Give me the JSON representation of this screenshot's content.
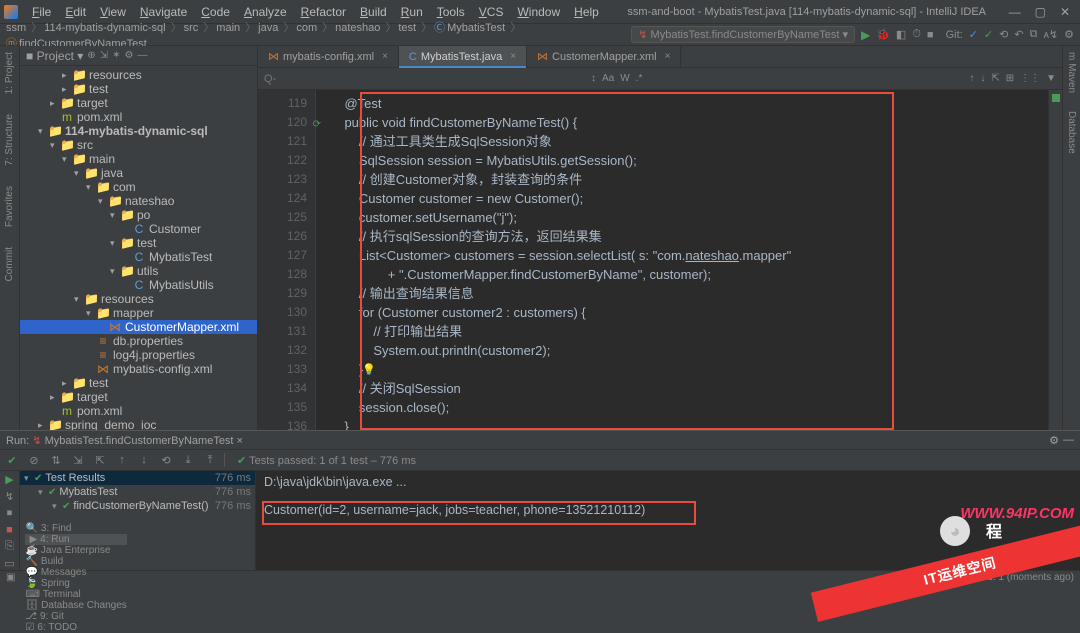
{
  "window": {
    "title": "ssm-and-boot - MybatisTest.java [114-mybatis-dynamic-sql] - IntelliJ IDEA",
    "menu": [
      "File",
      "Edit",
      "View",
      "Navigate",
      "Code",
      "Analyze",
      "Refactor",
      "Build",
      "Run",
      "Tools",
      "VCS",
      "Window",
      "Help"
    ]
  },
  "breadcrumb": {
    "items": [
      "ssm",
      "114-mybatis-dynamic-sql",
      "src",
      "main",
      "java",
      "com",
      "nateshao",
      "test",
      "MybatisTest",
      "findCustomerByNameTest"
    ],
    "run_config": "MybatisTest.findCustomerByNameTest",
    "git_label": "Git:"
  },
  "left_tools": [
    "1: Project",
    "7: Structure",
    "Favorites",
    "Commit"
  ],
  "right_tools": [
    "Maven",
    "Database"
  ],
  "project_tree": [
    {
      "d": 3,
      "a": "▸",
      "i": "📁",
      "c": "ic-folder-y",
      "t": "resources"
    },
    {
      "d": 3,
      "a": "▸",
      "i": "📁",
      "c": "ic-folder-b",
      "t": "test"
    },
    {
      "d": 2,
      "a": "▸",
      "i": "📁",
      "c": "ic-folder-y",
      "t": "target"
    },
    {
      "d": 2,
      "a": "",
      "i": "m",
      "c": "ic-file-x",
      "t": "pom.xml"
    },
    {
      "d": 1,
      "a": "▾",
      "i": "📁",
      "c": "ic-folder",
      "t": "114-mybatis-dynamic-sql",
      "bold": true
    },
    {
      "d": 2,
      "a": "▾",
      "i": "📁",
      "c": "ic-folder-b",
      "t": "src"
    },
    {
      "d": 3,
      "a": "▾",
      "i": "📁",
      "c": "ic-folder-b",
      "t": "main"
    },
    {
      "d": 4,
      "a": "▾",
      "i": "📁",
      "c": "ic-folder-b",
      "t": "java"
    },
    {
      "d": 5,
      "a": "▾",
      "i": "📁",
      "c": "ic-folder",
      "t": "com"
    },
    {
      "d": 6,
      "a": "▾",
      "i": "📁",
      "c": "ic-folder",
      "t": "nateshao"
    },
    {
      "d": 7,
      "a": "▾",
      "i": "📁",
      "c": "ic-folder",
      "t": "po"
    },
    {
      "d": 8,
      "a": "",
      "i": "C",
      "c": "ic-class",
      "t": "Customer"
    },
    {
      "d": 7,
      "a": "▾",
      "i": "📁",
      "c": "ic-folder",
      "t": "test"
    },
    {
      "d": 8,
      "a": "",
      "i": "C",
      "c": "ic-class",
      "t": "MybatisTest"
    },
    {
      "d": 7,
      "a": "▾",
      "i": "📁",
      "c": "ic-folder",
      "t": "utils"
    },
    {
      "d": 8,
      "a": "",
      "i": "C",
      "c": "ic-class",
      "t": "MybatisUtils"
    },
    {
      "d": 4,
      "a": "▾",
      "i": "📁",
      "c": "ic-folder-y",
      "t": "resources"
    },
    {
      "d": 5,
      "a": "▾",
      "i": "📁",
      "c": "ic-folder",
      "t": "mapper"
    },
    {
      "d": 6,
      "a": "",
      "i": "⋈",
      "c": "ic-file-p",
      "t": "CustomerMapper.xml",
      "sel": true
    },
    {
      "d": 5,
      "a": "",
      "i": "≡",
      "c": "ic-file-p",
      "t": "db.properties"
    },
    {
      "d": 5,
      "a": "",
      "i": "≡",
      "c": "ic-file-p",
      "t": "log4j.properties"
    },
    {
      "d": 5,
      "a": "",
      "i": "⋈",
      "c": "ic-file-p",
      "t": "mybatis-config.xml"
    },
    {
      "d": 3,
      "a": "▸",
      "i": "📁",
      "c": "ic-folder-b",
      "t": "test"
    },
    {
      "d": 2,
      "a": "▸",
      "i": "📁",
      "c": "ic-folder-y",
      "t": "target"
    },
    {
      "d": 2,
      "a": "",
      "i": "m",
      "c": "ic-file-x",
      "t": "pom.xml"
    },
    {
      "d": 1,
      "a": "▸",
      "i": "📁",
      "c": "ic-folder",
      "t": "spring_demo_ioc"
    }
  ],
  "tabs": [
    {
      "icon": "⋈",
      "label": "mybatis-config.xml",
      "active": false
    },
    {
      "icon": "C",
      "label": "MybatisTest.java",
      "active": true
    },
    {
      "icon": "⋈",
      "label": "CustomerMapper.xml",
      "active": false
    }
  ],
  "find_placeholder": "Q-",
  "code": {
    "first_line": 119,
    "lines": [
      "    <span class='ann'>@Test</span>",
      "    <span class='kw'>public void</span> <span class='mth'>findCustomerByNameTest</span>() {",
      "        <span class='cmt'>// 通过工具类生成SqlSession对象</span>",
      "        SqlSession session = MybatisUtils.<span class='sta'>getSession</span>();",
      "        <span class='cmt'>// 创建Customer对象，封装查询的条件</span>",
      "        Customer customer = <span class='kw'>new</span> Customer();",
      "        customer.setUsername(<span class='str'>\"j\"</span>);",
      "        <span class='cmt'>// 执行sqlSession的查询方法，返回结果集</span>",
      "        List&lt;Customer&gt; customers = session.selectList( <span class='par'>s:</span> <span class='str'>\"com.<u>nateshao</u>.mapper\"</span>",
      "                + <span class='str'>\".CustomerMapper.findCustomerByName\"</span>, customer);",
      "        <span class='cmt'>// 输出查询结果信息</span>",
      "        <span class='kw'>for</span> (Customer customer2 : customers) {",
      "            <span class='cmt'>// 打印输出结果</span>",
      "            System.<span class='sta'>out</span>.println(customer2);",
      "        }<span class='caret'></span>",
      "        <span class='cmt'>// 关闭SqlSession</span>",
      "        session.close();",
      "    }"
    ]
  },
  "run": {
    "title_prefix": "Run:",
    "config": "MybatisTest.findCustomerByNameTest",
    "tests_passed": "Tests passed: 1 of 1 test – 776 ms",
    "tree": [
      {
        "d": 0,
        "label": "Test Results",
        "time": "776 ms",
        "sel": true
      },
      {
        "d": 1,
        "label": "MybatisTest",
        "time": "776 ms"
      },
      {
        "d": 2,
        "label": "findCustomerByNameTest()",
        "time": "776 ms"
      }
    ],
    "console": [
      "D:\\java\\jdk\\bin\\java.exe ...",
      "",
      "Customer(id=2, username=jack, jobs=teacher, phone=13521210112)"
    ]
  },
  "bottom_tools": [
    {
      "i": "🔍",
      "t": "3: Find"
    },
    {
      "i": "▶",
      "t": "4: Run",
      "a": true
    },
    {
      "i": "☕",
      "t": "Java Enterprise"
    },
    {
      "i": "🔨",
      "t": "Build"
    },
    {
      "i": "💬",
      "t": "Messages"
    },
    {
      "i": "🍃",
      "t": "Spring"
    },
    {
      "i": "⌨",
      "t": "Terminal"
    },
    {
      "i": "🗄",
      "t": "Database Changes"
    },
    {
      "i": "⎇",
      "t": "9: Git"
    },
    {
      "i": "☑",
      "t": "6: TODO"
    }
  ],
  "status_text": "Tests passed: 1 (moments ago)",
  "status_right": "133:10   CRLF   UTF-8   4 spaces   Git: master   ⚓",
  "watermark": {
    "url": "WWW.94IP.COM",
    "text": "IT运维空间",
    "cn": "程"
  }
}
